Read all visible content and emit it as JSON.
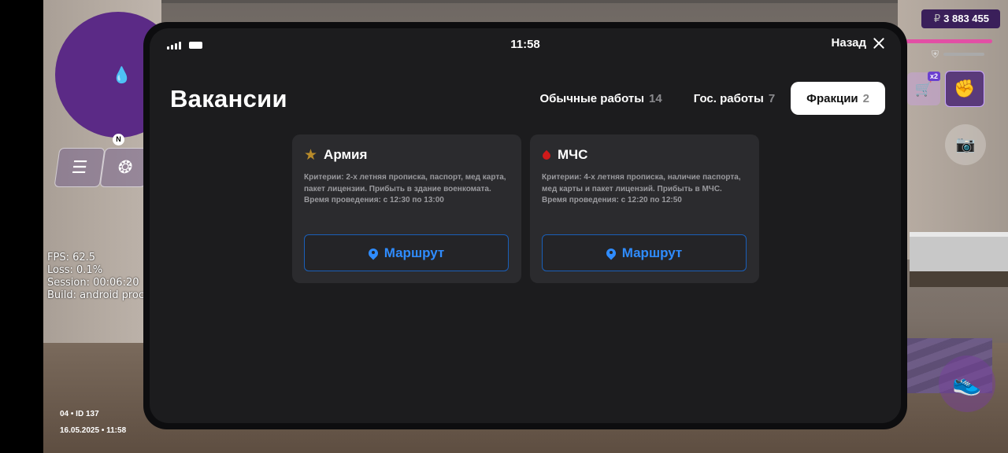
{
  "hud": {
    "stats": [
      "FPS: 62.5",
      "Loss: 0.1%",
      "Session: 00:06:20",
      "Build: android proc"
    ],
    "id_line": "04 • ID 137",
    "date_line": "16.05.2025 • 11:58",
    "money_symbol": "₽",
    "money": "3 883 455",
    "cart_multiplier": "x2",
    "compass_letter": "N"
  },
  "phone": {
    "status_time": "11:58",
    "back_label": "Назад",
    "title": "Вакансии",
    "tabs": [
      {
        "label": "Обычные работы",
        "count": "14",
        "active": false
      },
      {
        "label": "Гос. работы",
        "count": "7",
        "active": false
      },
      {
        "label": "Фракции",
        "count": "2",
        "active": true
      }
    ],
    "cards": [
      {
        "icon": "star-icon",
        "title": "Армия",
        "criteria": "Критерии: 2-х летняя прописка, паспорт, мед карта, пакет лицензии. Прибыть в здание военкомата.",
        "time": "Время проведения: с 12:30 по 13:00",
        "button": "Маршрут"
      },
      {
        "icon": "blood-drop-icon",
        "title": "МЧС",
        "criteria": "Критерии: 4-х летняя прописка, наличие паспорта, мед карты и пакет лицензий. Прибыть в МЧС.",
        "time": "Время проведения: с 12:20 по 12:50",
        "button": "Маршрут"
      }
    ]
  },
  "colors": {
    "accent_blue": "#2f8cff",
    "card_bg": "#2b2b2e",
    "screen_bg": "#1c1c1e",
    "star": "#b88b2a",
    "drop": "#d01a1a"
  }
}
